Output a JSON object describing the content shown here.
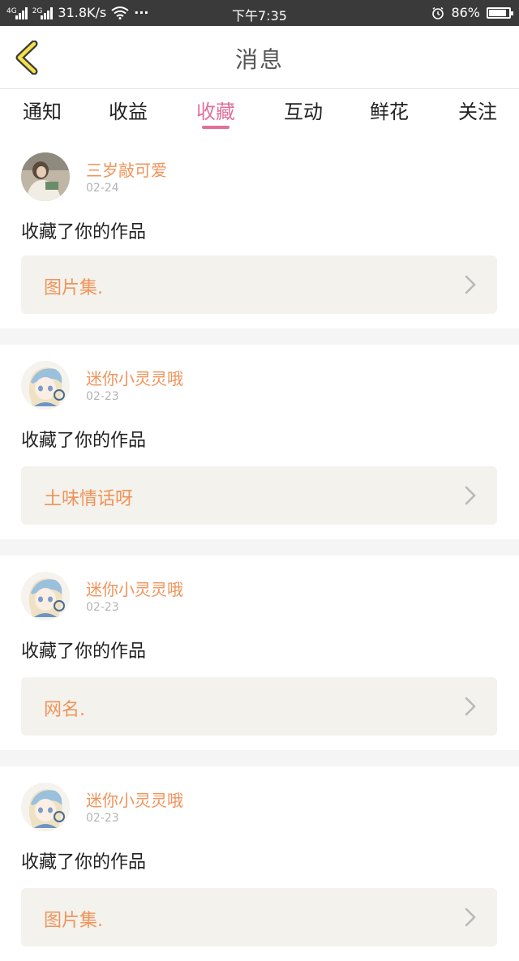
{
  "status_bar": {
    "net_4g": "4G",
    "net_2g": "2G",
    "speed": "31.8K/s",
    "dots": "···",
    "time": "下午7:35",
    "battery": "86%",
    "battery_level": 0.86
  },
  "header": {
    "title": "消息"
  },
  "tabs": [
    {
      "label": "通知",
      "active": false
    },
    {
      "label": "收益",
      "active": false
    },
    {
      "label": "收藏",
      "active": true
    },
    {
      "label": "互动",
      "active": false
    },
    {
      "label": "鲜花",
      "active": false
    },
    {
      "label": "关注",
      "active": false
    }
  ],
  "colors": {
    "accent": "#e0709a",
    "name": "#f0935a",
    "card_bg": "#f3f2ec"
  },
  "items": [
    {
      "user": "三岁敲可爱",
      "date": "02-24",
      "action": "收藏了你的作品",
      "work": "图片集."
    },
    {
      "user": "迷你小灵灵哦",
      "date": "02-23",
      "action": "收藏了你的作品",
      "work": "土味情话呀"
    },
    {
      "user": "迷你小灵灵哦",
      "date": "02-23",
      "action": "收藏了你的作品",
      "work": "网名."
    },
    {
      "user": "迷你小灵灵哦",
      "date": "02-23",
      "action": "收藏了你的作品",
      "work": "图片集."
    }
  ]
}
